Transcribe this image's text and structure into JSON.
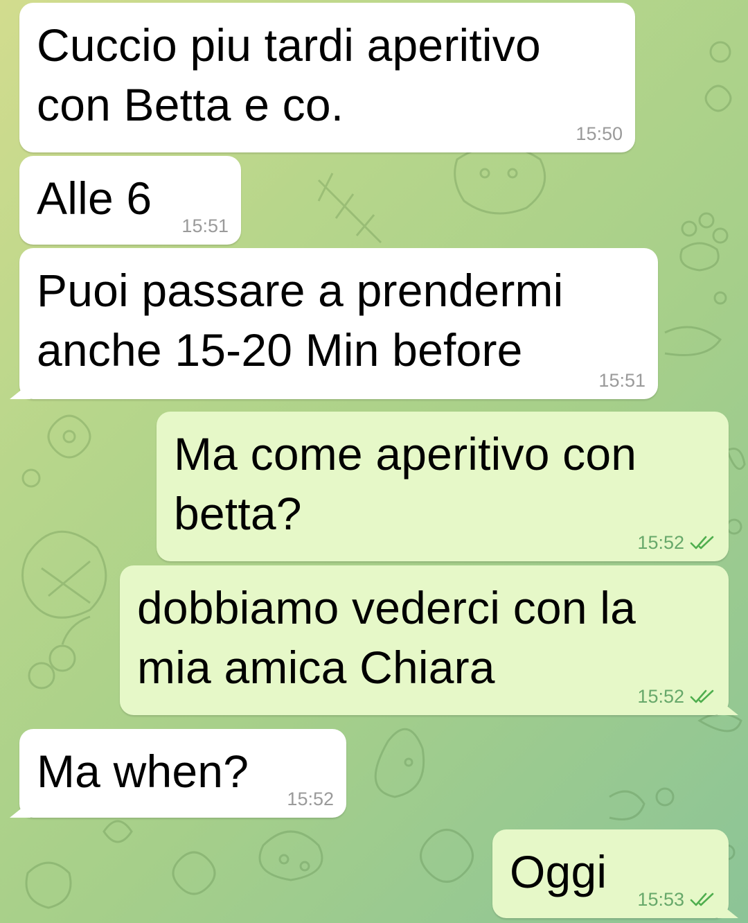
{
  "colors": {
    "incoming_bubble": "#ffffff",
    "outgoing_bubble": "#e6f8c8",
    "incoming_time": "#9a9a9a",
    "outgoing_time": "#67a86a",
    "read_check": "#4fae4e"
  },
  "messages": [
    {
      "direction": "incoming",
      "text": "Cuccio piu tardi aperitivo\ncon Betta e co.",
      "time": "15:50"
    },
    {
      "direction": "incoming",
      "text": "Alle 6",
      "time": "15:51"
    },
    {
      "direction": "incoming",
      "text": "Puoi passare a prendermi\nanche 15-20 Min before",
      "time": "15:51"
    },
    {
      "direction": "outgoing",
      "text": "Ma come aperitivo con\nbetta?",
      "time": "15:52",
      "status_icon": "double-check-icon"
    },
    {
      "direction": "outgoing",
      "text": "dobbiamo vederci con la\nmia amica Chiara",
      "time": "15:52",
      "status_icon": "double-check-icon"
    },
    {
      "direction": "incoming",
      "text": "Ma when?",
      "time": "15:52"
    },
    {
      "direction": "outgoing",
      "text": "Oggi",
      "time": "15:53",
      "status_icon": "double-check-icon"
    }
  ]
}
